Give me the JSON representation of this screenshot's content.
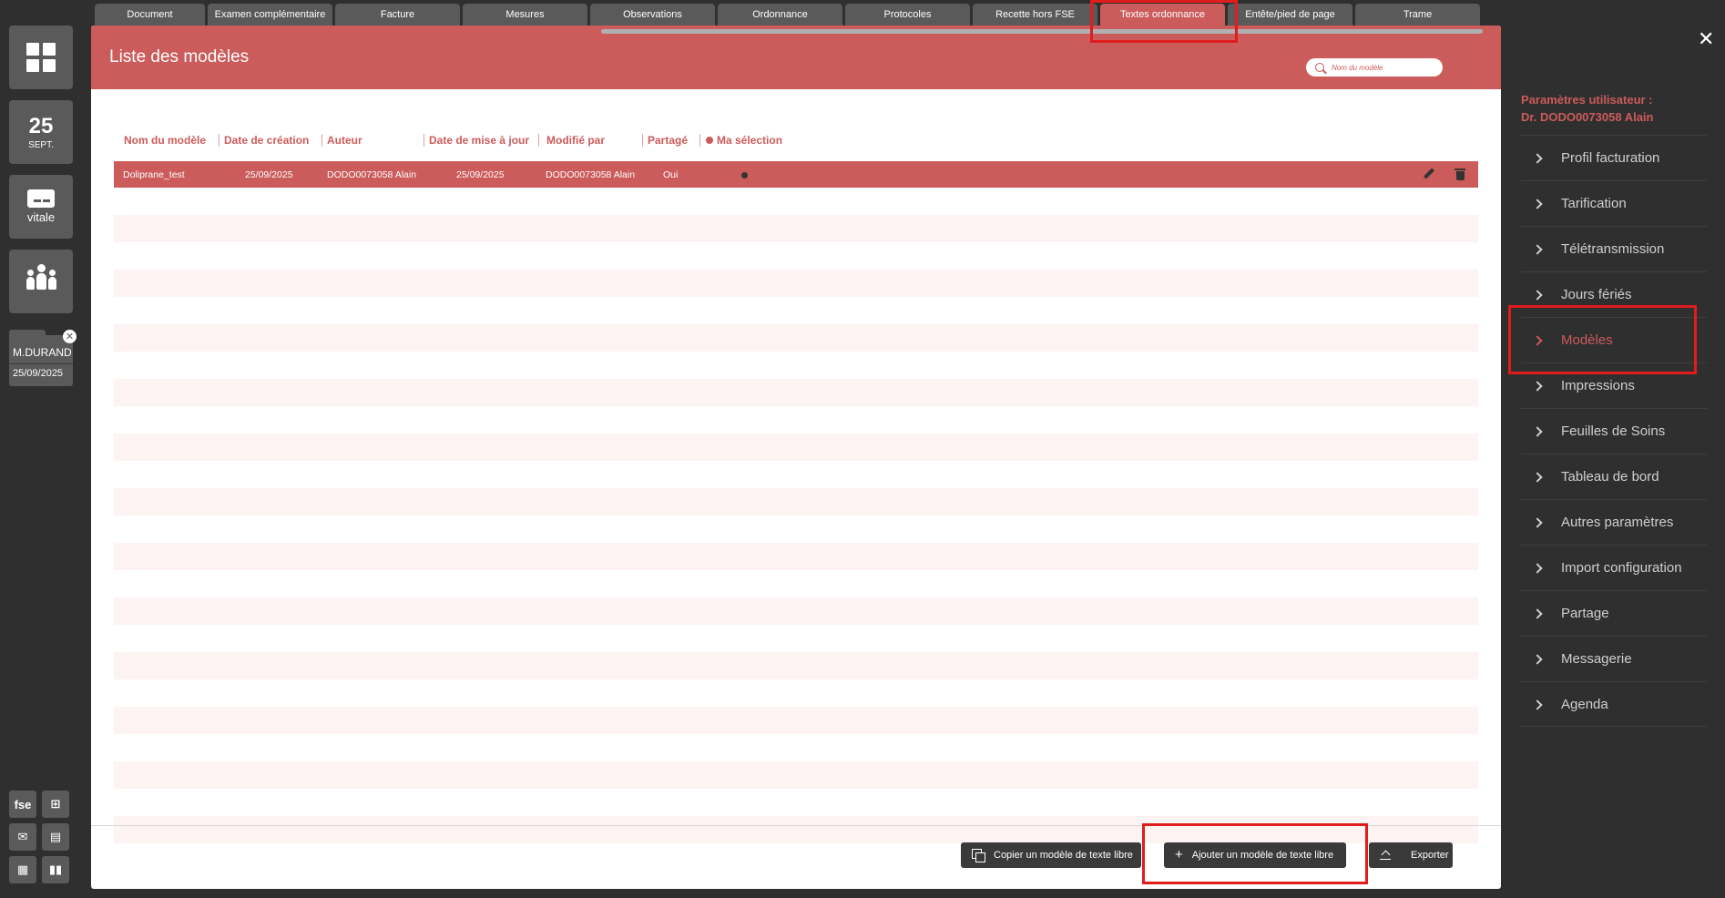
{
  "left_sidebar": {
    "date_day": "25",
    "date_month": "SEPT.",
    "vitale_label": "vitale",
    "patient_name": "M.DURAND",
    "patient_date": "25/09/2025",
    "fse_label": "fse"
  },
  "tabs": [
    "Document",
    "Examen complémentaire",
    "Facture",
    "Mesures",
    "Observations",
    "Ordonnance",
    "Protocoles",
    "Recette hors FSE",
    "Textes ordonnance",
    "Entête/pied de page",
    "Trame"
  ],
  "active_tab": "Textes ordonnance",
  "panel": {
    "title": "Liste des modèles",
    "search_placeholder": "Nom du modèle",
    "columns": [
      "Nom du modèle",
      "Date de création",
      "Auteur",
      "Date de mise à jour",
      "Modifié par",
      "Partagé",
      "Ma sélection"
    ],
    "rows": [
      {
        "name": "Doliprane_test",
        "created": "25/09/2025",
        "author": "DODO0073058 Alain",
        "updated": "25/09/2025",
        "modified_by": "DODO0073058 Alain",
        "shared": "Oui",
        "selected": true
      }
    ],
    "buttons": {
      "copy": "Copier un modèle de texte libre",
      "add": "Ajouter un modèle de texte libre",
      "export": "Exporter"
    }
  },
  "settings": {
    "title_line1": "Paramètres utilisateur :",
    "title_line2": "Dr. DODO0073058 Alain",
    "items": [
      "Profil facturation",
      "Tarification",
      "Télétransmission",
      "Jours fériés",
      "Modèles",
      "Impressions",
      "Feuilles de Soins",
      "Tableau de bord",
      "Autres paramètres",
      "Import configuration",
      "Partage",
      "Messagerie",
      "Agenda"
    ],
    "active_item": "Modèles"
  },
  "colors": {
    "accent": "#cc5b5b",
    "background": "#2f2f2f",
    "tile": "#5a5a5a",
    "highlight": "#e01c1c"
  }
}
